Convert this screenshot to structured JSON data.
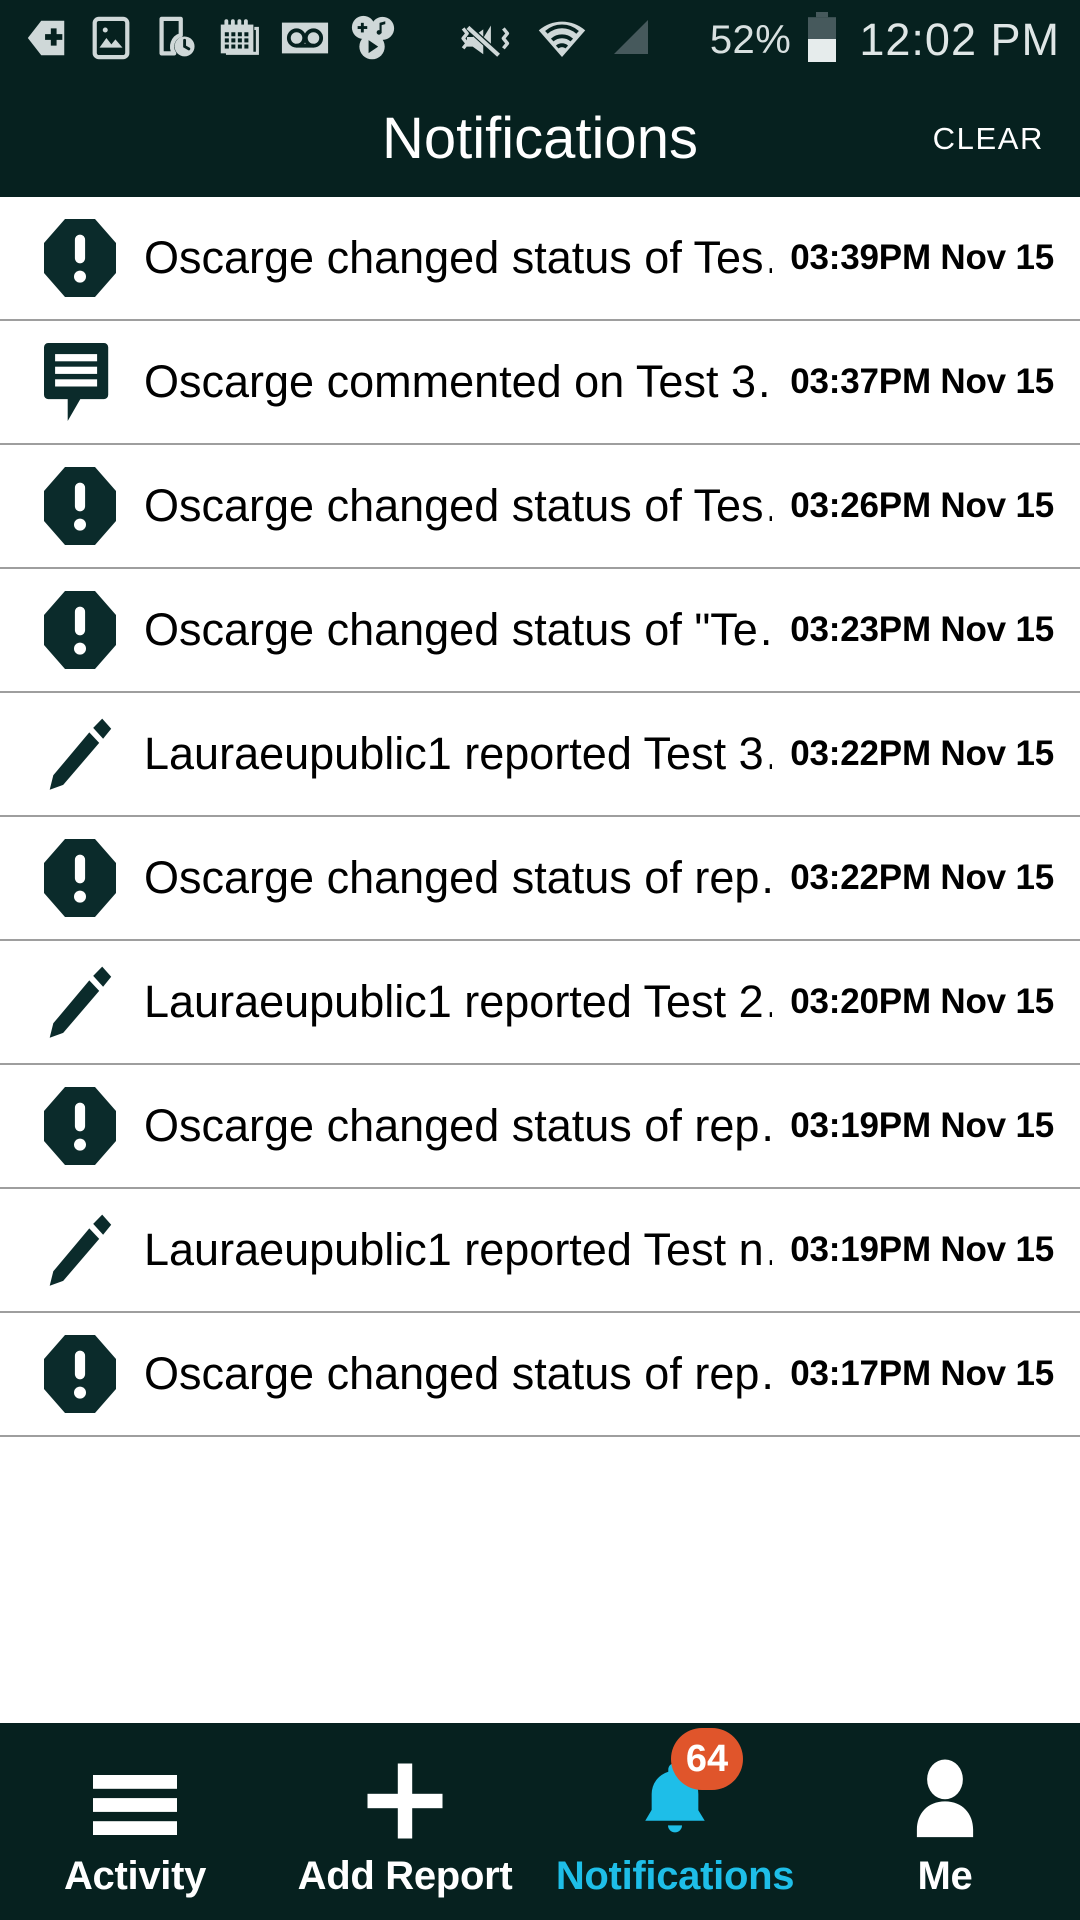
{
  "status_bar": {
    "icons": [
      "bookmark-add-icon",
      "image-icon",
      "phone-clock-icon",
      "calendar-icon",
      "voicemail-icon",
      "game-music-play-icon",
      "vibrate-mute-icon",
      "wifi-icon",
      "cellular-signal-icon"
    ],
    "battery_percent": "52%",
    "time": "12:02 PM",
    "background_color": "#06211F",
    "foreground_color": "#dbe3e3"
  },
  "header": {
    "title": "Notifications",
    "clear_label": "CLEAR",
    "background_color": "#06211F",
    "title_color": "#ffffff"
  },
  "notifications": [
    {
      "icon": "alert-octagon-icon",
      "text": "Oscarge changed status of Tes…",
      "time": "03:39PM Nov 15"
    },
    {
      "icon": "comment-icon",
      "text": "Oscarge commented on Test 3…",
      "time": "03:37PM Nov 15"
    },
    {
      "icon": "alert-octagon-icon",
      "text": "Oscarge changed status of Tes…",
      "time": "03:26PM Nov 15"
    },
    {
      "icon": "alert-octagon-icon",
      "text": "Oscarge changed status of \"Te…",
      "time": "03:23PM Nov 15"
    },
    {
      "icon": "pencil-icon",
      "text": "Lauraeupublic1 reported Test 3…",
      "time": "03:22PM Nov 15"
    },
    {
      "icon": "alert-octagon-icon",
      "text": "Oscarge changed status of rep…",
      "time": "03:22PM Nov 15"
    },
    {
      "icon": "pencil-icon",
      "text": "Lauraeupublic1 reported Test 2…",
      "time": "03:20PM Nov 15"
    },
    {
      "icon": "alert-octagon-icon",
      "text": "Oscarge changed status of rep…",
      "time": "03:19PM Nov 15"
    },
    {
      "icon": "pencil-icon",
      "text": "Lauraeupublic1 reported Test n…",
      "time": "03:19PM Nov 15"
    },
    {
      "icon": "alert-octagon-icon",
      "text": "Oscarge changed status of rep…",
      "time": "03:17PM Nov 15"
    }
  ],
  "bottom_nav": {
    "background_color": "#06211F",
    "active_color": "#1EBEE8",
    "badge_color": "#E0552B",
    "items": [
      {
        "icon": "hamburger-menu-icon",
        "label": "Activity",
        "active": false,
        "badge": ""
      },
      {
        "icon": "plus-icon",
        "label": "Add Report",
        "active": false,
        "badge": ""
      },
      {
        "icon": "bell-icon",
        "label": "Notifications",
        "active": true,
        "badge": "64"
      },
      {
        "icon": "person-icon",
        "label": "Me",
        "active": false,
        "badge": ""
      }
    ]
  }
}
